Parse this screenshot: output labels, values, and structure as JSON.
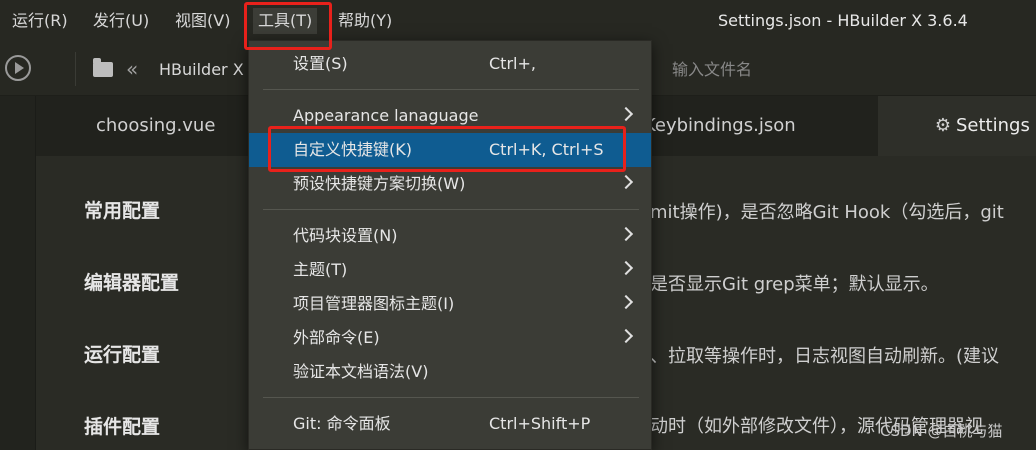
{
  "menubar": {
    "items": [
      {
        "label": "运行(R)"
      },
      {
        "label": "发行(U)"
      },
      {
        "label": "视图(V)"
      },
      {
        "label": "工具(T)"
      },
      {
        "label": "帮助(Y)"
      }
    ],
    "window_title": "Settings.json - HBuilder X 3.6.4"
  },
  "toolbar": {
    "breadcrumb": "HBuilder X",
    "file_search_placeholder": "输入文件名"
  },
  "tabs": [
    {
      "label": "choosing.vue"
    },
    {
      "label": "Keybindings.json"
    },
    {
      "label": "Settings"
    }
  ],
  "settings": {
    "sections": [
      {
        "title": "常用配置",
        "desc": "mit操作)，是否忽略Git Hook（勾选后，git"
      },
      {
        "title": "编辑器配置",
        "desc": "是否显示Git grep菜单；默认显示。"
      },
      {
        "title": "运行配置",
        "desc": "、拉取等操作时，日志视图自动刷新。(建议"
      },
      {
        "title": "插件配置",
        "desc": "动时（如外部修改文件），源代码管理器视"
      }
    ]
  },
  "tools_menu": {
    "items": [
      {
        "label": "设置(S)",
        "shortcut": "Ctrl+,",
        "submenu": false
      },
      {
        "label": "Appearance lanaguage",
        "shortcut": "",
        "submenu": true
      },
      {
        "label": "自定义快捷键(K)",
        "shortcut": "Ctrl+K, Ctrl+S",
        "submenu": false,
        "highlighted": true
      },
      {
        "label": "预设快捷键方案切换(W)",
        "shortcut": "",
        "submenu": true
      },
      {
        "label": "代码块设置(N)",
        "shortcut": "",
        "submenu": true
      },
      {
        "label": "主题(T)",
        "shortcut": "",
        "submenu": true
      },
      {
        "label": "项目管理器图标主题(I)",
        "shortcut": "",
        "submenu": true
      },
      {
        "label": "外部命令(E)",
        "shortcut": "",
        "submenu": true
      },
      {
        "label": "验证本文档语法(V)",
        "shortcut": "",
        "submenu": false
      },
      {
        "label": "Git: 命令面板",
        "shortcut": "Ctrl+Shift+P",
        "submenu": false
      }
    ]
  },
  "watermark": "CSDN @白桃与猫",
  "colors": {
    "annotation_red": "#e8211b",
    "menu_highlight": "#0f5c91",
    "background": "#272822"
  }
}
